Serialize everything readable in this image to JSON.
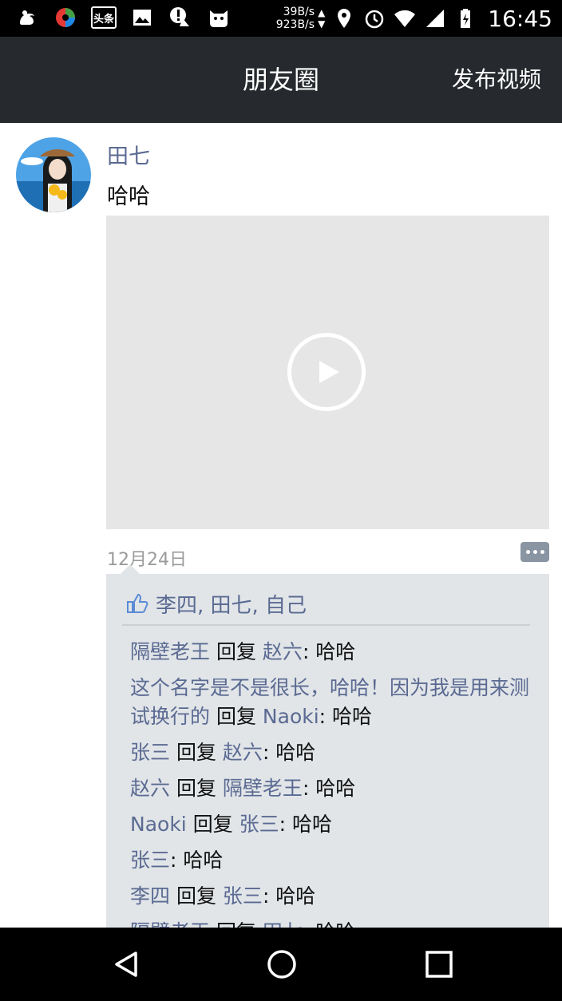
{
  "status_bar": {
    "speed_up": "39B/s",
    "speed_down": "923B/s",
    "time": "16:45",
    "toutiao_label": "头条",
    "icons": [
      "uc-browser-icon",
      "app-icon",
      "toutiao-icon",
      "gallery-icon",
      "alert-icon",
      "cat-icon",
      "location-icon",
      "alarm-icon",
      "wifi-icon",
      "signal-icon",
      "battery-icon"
    ]
  },
  "header": {
    "title": "朋友圈",
    "publish_label": "发布视频"
  },
  "post": {
    "username": "田七",
    "text": "哈哈",
    "date": "12月24日"
  },
  "likes": {
    "names": "李四, 田七, 自己"
  },
  "comments": [
    {
      "from": "隔壁老王",
      "reply": " 回复 ",
      "to": "赵六",
      "text": ": 哈哈"
    },
    {
      "from": "这个名字是不是很长，哈哈！因为我是用来测试换行的",
      "reply": " 回复 ",
      "to": "Naoki",
      "text": ": 哈哈"
    },
    {
      "from": "张三",
      "reply": " 回复 ",
      "to": "赵六",
      "text": ": 哈哈"
    },
    {
      "from": "赵六",
      "reply": " 回复 ",
      "to": "隔壁老王",
      "text": ": 哈哈"
    },
    {
      "from": "Naoki",
      "reply": " 回复 ",
      "to": "张三",
      "text": ": 哈哈"
    },
    {
      "from": "张三",
      "reply": "",
      "to": "",
      "text": ": 哈哈"
    },
    {
      "from": "李四",
      "reply": " 回复 ",
      "to": "张三",
      "text": ": 哈哈"
    },
    {
      "from": "隔壁老王",
      "reply": " 回复 ",
      "to": "田七",
      "text": ": 哈哈"
    }
  ],
  "colors": {
    "titlebar": "#262a2e",
    "link": "#5b6a92",
    "comment_bg": "#e1e5e8"
  }
}
